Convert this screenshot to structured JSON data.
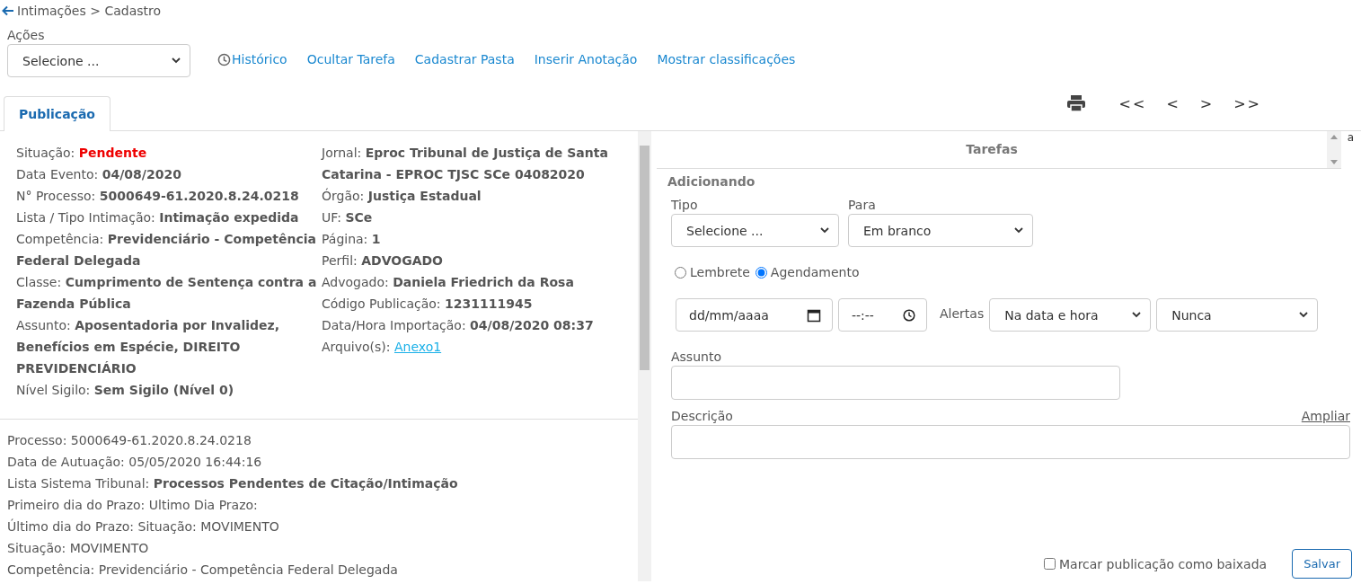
{
  "breadcrumb": "Intimações > Cadastro",
  "actions": {
    "label": "Ações",
    "value": "Selecione ..."
  },
  "links": [
    {
      "label": "Histórico",
      "kind": "history"
    },
    {
      "label": "Ocultar Tarefa",
      "kind": "plain"
    },
    {
      "label": "Cadastrar Pasta",
      "kind": "plain"
    },
    {
      "label": "Inserir Anotação",
      "kind": "plain"
    },
    {
      "label": "Mostrar classificações",
      "kind": "plain"
    }
  ],
  "tabs": [
    {
      "label": "Publicação",
      "selected": true
    }
  ],
  "pager": [
    "<<",
    "<",
    ">",
    ">>"
  ],
  "publication": {
    "column_1": [
      {
        "label": "Situação:",
        "value": "Pendente",
        "kind": "status"
      },
      {
        "label": "Data Evento:",
        "value": "04/08/2020",
        "kind": "bold"
      },
      {
        "label": "N° Processo:",
        "value": "5000649-61.2020.8.24.0218",
        "kind": "bold"
      },
      {
        "label": "Lista / Tipo Intimação:",
        "value": "Intimação expedida",
        "kind": "bold"
      },
      {
        "label": "Competência:",
        "value": "Previdenciário - Competência Federal Delegada",
        "kind": "bold"
      },
      {
        "label": "Classe:",
        "value": "Cumprimento de Sentença contra a Fazenda Pública",
        "kind": "bold"
      },
      {
        "label": "Assunto:",
        "value": "Aposentadoria por Invalidez, Benefícios em Espécie, DIREITO PREVIDENCIÁRIO",
        "kind": "bold"
      },
      {
        "label": "Nível Sigilo:",
        "value": "Sem Sigilo (Nível 0)",
        "kind": "bold"
      }
    ],
    "column_2": [
      {
        "label": "Jornal:",
        "value": "Eproc Tribunal de Justiça de Santa Catarina - EPROC TJSC SCe 04082020",
        "kind": "bold"
      },
      {
        "label": "Órgão:",
        "value": "Justiça Estadual",
        "kind": "bold"
      },
      {
        "label": "UF:",
        "value": "SCe",
        "kind": "bold"
      },
      {
        "label": "Página:",
        "value": "1",
        "kind": "bold"
      },
      {
        "label": "Perfil:",
        "value": "ADVOGADO",
        "kind": "bold"
      },
      {
        "label": "Advogado:",
        "value": "Daniela Friedrich da Rosa",
        "kind": "bold"
      },
      {
        "label": "Código Publicação:",
        "value": "1231111945",
        "kind": "bold"
      },
      {
        "label": "Data/Hora Importação:",
        "value": "04/08/2020 08:37",
        "kind": "bold"
      },
      {
        "label": "Arquivo(s):",
        "value": "Anexo1",
        "kind": "link"
      }
    ],
    "details": [
      "Processo: 5000649-61.2020.8.24.0218",
      "Data de Autuação: 05/05/2020 16:44:16",
      "Lista Sistema Tribunal: **Processos Pendentes de Citação/Intimação**",
      "Primeiro dia do Prazo: Ultimo Dia Prazo:",
      "Último dia do Prazo: Situação: MOVIMENTO",
      "Situação: MOVIMENTO",
      "Competência: Previdenciário - Competência Federal Delegada"
    ]
  },
  "tasks": {
    "header": "Tarefas",
    "edge_text": "a",
    "mode": "Adicionando",
    "tipo": {
      "label": "Tipo",
      "value": "Selecione ..."
    },
    "para": {
      "label": "Para",
      "value": "Em branco"
    },
    "radios": [
      {
        "label": "Lembrete",
        "selected": false
      },
      {
        "label": "Agendamento",
        "selected": true
      }
    ],
    "date": {
      "placeholder": "dd/mm/aaaa"
    },
    "time": {
      "placeholder": "--:--"
    },
    "alerts": {
      "label": "Alertas",
      "when": "Na data e hora",
      "repeat": "Nunca"
    },
    "subject": {
      "label": "Assunto"
    },
    "description": {
      "label": "Descrição",
      "expand": "Ampliar"
    },
    "mark_done": {
      "label": "Marcar publicação como baixada",
      "checked": false
    },
    "save": "Salvar"
  }
}
